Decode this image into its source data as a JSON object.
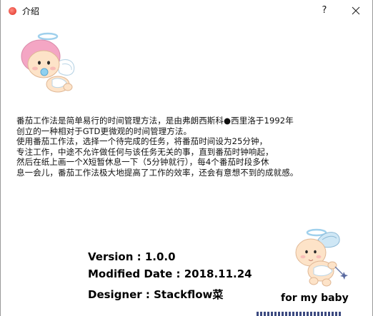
{
  "window": {
    "title": "介绍",
    "help_button": "?",
    "icon": "tomato-icon",
    "close_icon": "close-icon"
  },
  "description": {
    "lines": [
      "番茄工作法是简单易行的时间管理方法，是由弗朗西斯科●西里洛于1992年",
      "创立的一种相对于GTD更微观的时间管理方法。",
      "使用番茄工作法，选择一个待完成的任务，将番茄时间设为25分钟，",
      "专注工作，中途不允许做任何与该任务无关的事，直到番茄时钟响起，",
      "然后在纸上画一个X短暂休息一下（5分钟就行），每4个番茄时段多休",
      "息一会儿，番茄工作法极大地提高了工作的效率，还会有意想不到的成就感。"
    ]
  },
  "info": {
    "version": "Version : 1.0.0",
    "modified_date": "Modified Date : 2018.11.24",
    "designer": "Designer : Stackflow菜"
  },
  "dedication": "for my baby",
  "illustrations": {
    "top": "angel-baby-icon",
    "bottom": "angel-baby-icon"
  },
  "colors": {
    "tomato": "#e8483d",
    "baby_hair": "#f4a6c4",
    "baby_skin": "#fde3c8",
    "wing": "#cfe7f5"
  }
}
